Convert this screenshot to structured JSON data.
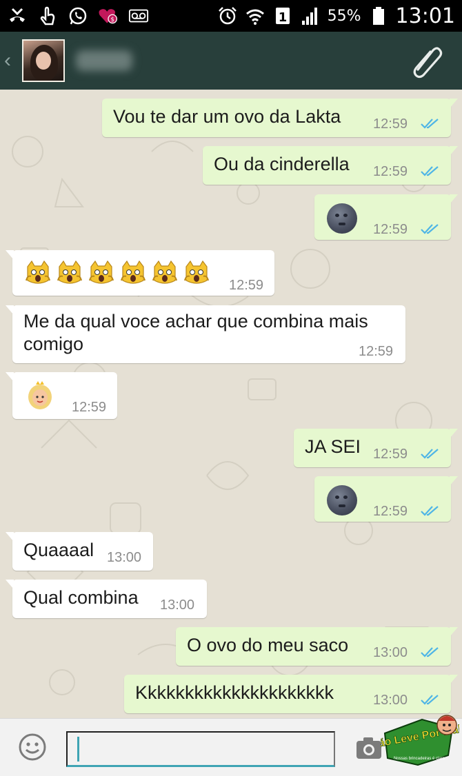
{
  "status_bar": {
    "battery": "55%",
    "time": "13:01",
    "sim_slot": "1",
    "icons": [
      "missed-call-icon",
      "touch-icon",
      "whatsapp-icon",
      "heart-money-icon",
      "voicemail-icon",
      "alarm-icon",
      "wifi-icon",
      "sim-icon",
      "signal-icon",
      "battery-icon"
    ]
  },
  "header": {
    "contact_name": "",
    "icons": [
      "back-icon",
      "avatar",
      "paperclip-icon"
    ]
  },
  "messages": [
    {
      "dir": "out",
      "text": "Vou te dar um ovo da Lakta",
      "time": "12:59",
      "read": true
    },
    {
      "dir": "out",
      "text": "Ou da cinderella",
      "time": "12:59",
      "read": true
    },
    {
      "dir": "out",
      "text": "",
      "emoji": "new-moon-face-icon",
      "time": "12:59",
      "read": true
    },
    {
      "dir": "in",
      "text": "",
      "emoji": "scared-cat-icon x6",
      "time": "12:59"
    },
    {
      "dir": "in",
      "text": "Me da qual voce achar que combina mais comigo",
      "line1": "Me da qual voce achar que combina mais",
      "line2": "comigo",
      "time": "12:59"
    },
    {
      "dir": "in",
      "text": "",
      "emoji": "princess-icon",
      "time": "12:59"
    },
    {
      "dir": "out",
      "text": "JA SEI",
      "time": "12:59",
      "read": true
    },
    {
      "dir": "out",
      "text": "",
      "emoji": "new-moon-face-icon",
      "time": "12:59",
      "read": true
    },
    {
      "dir": "in",
      "text": "Quaaaal",
      "time": "13:00"
    },
    {
      "dir": "in",
      "text": "Qual combina",
      "time": "13:00"
    },
    {
      "dir": "out",
      "text": "O ovo do meu saco",
      "time": "13:00",
      "read": true
    },
    {
      "dir": "out",
      "text": "Kkkkkkkkkkkkkkkkkkkkk",
      "time": "13:00",
      "read": true
    }
  ],
  "input_bar": {
    "value": "",
    "icons": [
      "smiley-icon",
      "camera-icon"
    ]
  },
  "watermark": {
    "text_main": "Não Leve Por Mal",
    "text_sub": "Nossas brincadeiras é claro"
  },
  "colors": {
    "header_bg": "#283f3b",
    "outgoing_bubble": "#e6f8cf",
    "incoming_bubble": "#ffffff",
    "read_ticks": "#4fb5e6",
    "input_accent": "#3fa4b4"
  }
}
